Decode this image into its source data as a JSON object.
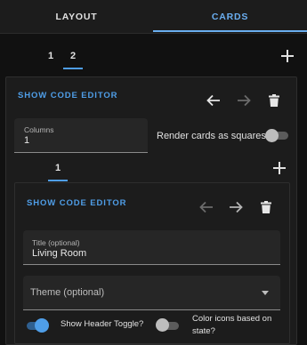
{
  "tabs": {
    "layout": "LAYOUT",
    "cards": "CARDS"
  },
  "view_tabs": [
    "1",
    "2"
  ],
  "card": {
    "show_code_editor": "SHOW CODE EDITOR",
    "columns_label": "Columns",
    "columns_value": "1",
    "render_squares_label": "Render cards as squares",
    "sub_tabs": [
      "1"
    ]
  },
  "inner_card": {
    "show_code_editor": "SHOW CODE EDITOR",
    "title_label": "Title (optional)",
    "title_value": "Living Room",
    "theme_placeholder": "Theme (optional)",
    "show_header_toggle_label": "Show Header Toggle?",
    "color_icons_label_line1": "Color icons based on",
    "color_icons_label_line2": "state?"
  },
  "colors": {
    "accent": "#6aaef0",
    "toggle_on": "#4f9ee8",
    "background": "#111111",
    "card": "#1c1c1c"
  },
  "icons": [
    "arrow-left-icon",
    "arrow-right-icon",
    "trash-icon",
    "plus-icon",
    "dropdown-arrow-icon"
  ]
}
